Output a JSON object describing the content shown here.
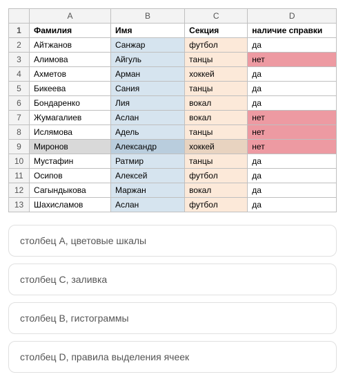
{
  "columns": {
    "a": "A",
    "b": "B",
    "c": "C",
    "d": "D"
  },
  "headers": {
    "a": "Фамилия",
    "b": "Имя",
    "c": "Секция",
    "d": "наличие справки"
  },
  "rows": [
    {
      "n": "2",
      "a": "Айтжанов",
      "b": "Санжар",
      "c": "футбол",
      "d": "да",
      "no": false,
      "sel": false
    },
    {
      "n": "3",
      "a": "Алимова",
      "b": "Айгуль",
      "c": "танцы",
      "d": "нет",
      "no": true,
      "sel": false
    },
    {
      "n": "4",
      "a": "Ахметов",
      "b": "Арман",
      "c": "хоккей",
      "d": "да",
      "no": false,
      "sel": false
    },
    {
      "n": "5",
      "a": "Бикеева",
      "b": "Сания",
      "c": "танцы",
      "d": "да",
      "no": false,
      "sel": false
    },
    {
      "n": "6",
      "a": "Бондаренко",
      "b": "Лия",
      "c": "вокал",
      "d": "да",
      "no": false,
      "sel": false
    },
    {
      "n": "7",
      "a": "Жумагалиев",
      "b": "Аслан",
      "c": "вокал",
      "d": "нет",
      "no": true,
      "sel": false
    },
    {
      "n": "8",
      "a": "Ислямова",
      "b": "Адель",
      "c": "танцы",
      "d": "нет",
      "no": true,
      "sel": false
    },
    {
      "n": "9",
      "a": "Миронов",
      "b": "Александр",
      "c": "хоккей",
      "d": "нет",
      "no": true,
      "sel": true
    },
    {
      "n": "10",
      "a": "Мустафин",
      "b": "Ратмир",
      "c": "танцы",
      "d": "да",
      "no": false,
      "sel": false
    },
    {
      "n": "11",
      "a": "Осипов",
      "b": "Алексей",
      "c": "футбол",
      "d": "да",
      "no": false,
      "sel": false
    },
    {
      "n": "12",
      "a": "Сагындыкова",
      "b": "Маржан",
      "c": "вокал",
      "d": "да",
      "no": false,
      "sel": false
    },
    {
      "n": "13",
      "a": "Шахисламов",
      "b": "Аслан",
      "c": "футбол",
      "d": "да",
      "no": false,
      "sel": false
    }
  ],
  "header_row_num": "1",
  "options": [
    "столбец A, цветовые шкалы",
    "столбец C, заливка",
    "столбец B, гистограммы",
    "столбец D, правила выделения ячеек"
  ],
  "chart_data": {
    "type": "table",
    "title": "",
    "columns": [
      "Фамилия",
      "Имя",
      "Секция",
      "наличие справки"
    ],
    "rows": [
      [
        "Айтжанов",
        "Санжар",
        "футбол",
        "да"
      ],
      [
        "Алимова",
        "Айгуль",
        "танцы",
        "нет"
      ],
      [
        "Ахметов",
        "Арман",
        "хоккей",
        "да"
      ],
      [
        "Бикеева",
        "Сания",
        "танцы",
        "да"
      ],
      [
        "Бондаренко",
        "Лия",
        "вокал",
        "да"
      ],
      [
        "Жумагалиев",
        "Аслан",
        "вокал",
        "нет"
      ],
      [
        "Ислямова",
        "Адель",
        "танцы",
        "нет"
      ],
      [
        "Миронов",
        "Александр",
        "хоккей",
        "нет"
      ],
      [
        "Мустафин",
        "Ратмир",
        "танцы",
        "да"
      ],
      [
        "Осипов",
        "Алексей",
        "футбол",
        "да"
      ],
      [
        "Сагындыкова",
        "Маржан",
        "вокал",
        "да"
      ],
      [
        "Шахисламов",
        "Аслан",
        "футбол",
        "да"
      ]
    ]
  }
}
